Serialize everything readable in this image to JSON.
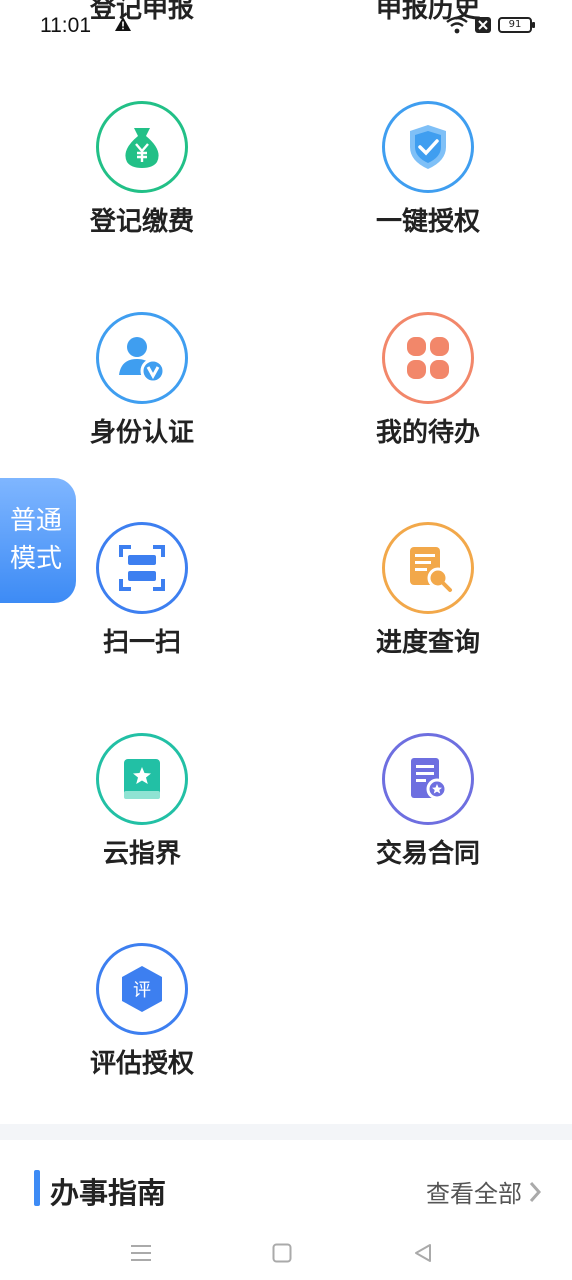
{
  "status_bar": {
    "time": "11:01",
    "battery": "91",
    "icons": [
      "warning-icon",
      "wifi-icon",
      "sim-off-icon",
      "battery-icon"
    ]
  },
  "top_cut_items": [
    "登记申报",
    "申报历史"
  ],
  "grid": [
    {
      "label": "登记缴费",
      "icon": "money-bag-icon",
      "color": "#22c087"
    },
    {
      "label": "一键授权",
      "icon": "shield-check-icon",
      "color": "#3f9ef0"
    },
    {
      "label": "身份认证",
      "icon": "user-verified-icon",
      "color": "#3f9ef0"
    },
    {
      "label": "我的待办",
      "icon": "four-grid-icon",
      "color": "#f2876a"
    },
    {
      "label": "扫一扫",
      "icon": "scan-icon",
      "color": "#3d7ff0"
    },
    {
      "label": "进度查询",
      "icon": "document-search-icon",
      "color": "#f2a84a"
    },
    {
      "label": "云指界",
      "icon": "book-star-icon",
      "color": "#22c0a5"
    },
    {
      "label": "交易合同",
      "icon": "contract-icon",
      "color": "#6e6fe0"
    },
    {
      "label": "评估授权",
      "icon": "badge-ping-icon",
      "color": "#3d7ff0",
      "badge_text": "评"
    }
  ],
  "mode_tab": {
    "line1": "普通",
    "line2": "模式"
  },
  "guide": {
    "title": "办事指南",
    "view_all": "查看全部"
  },
  "nav": {
    "icons": [
      "menu-icon",
      "home-icon",
      "back-icon"
    ]
  }
}
